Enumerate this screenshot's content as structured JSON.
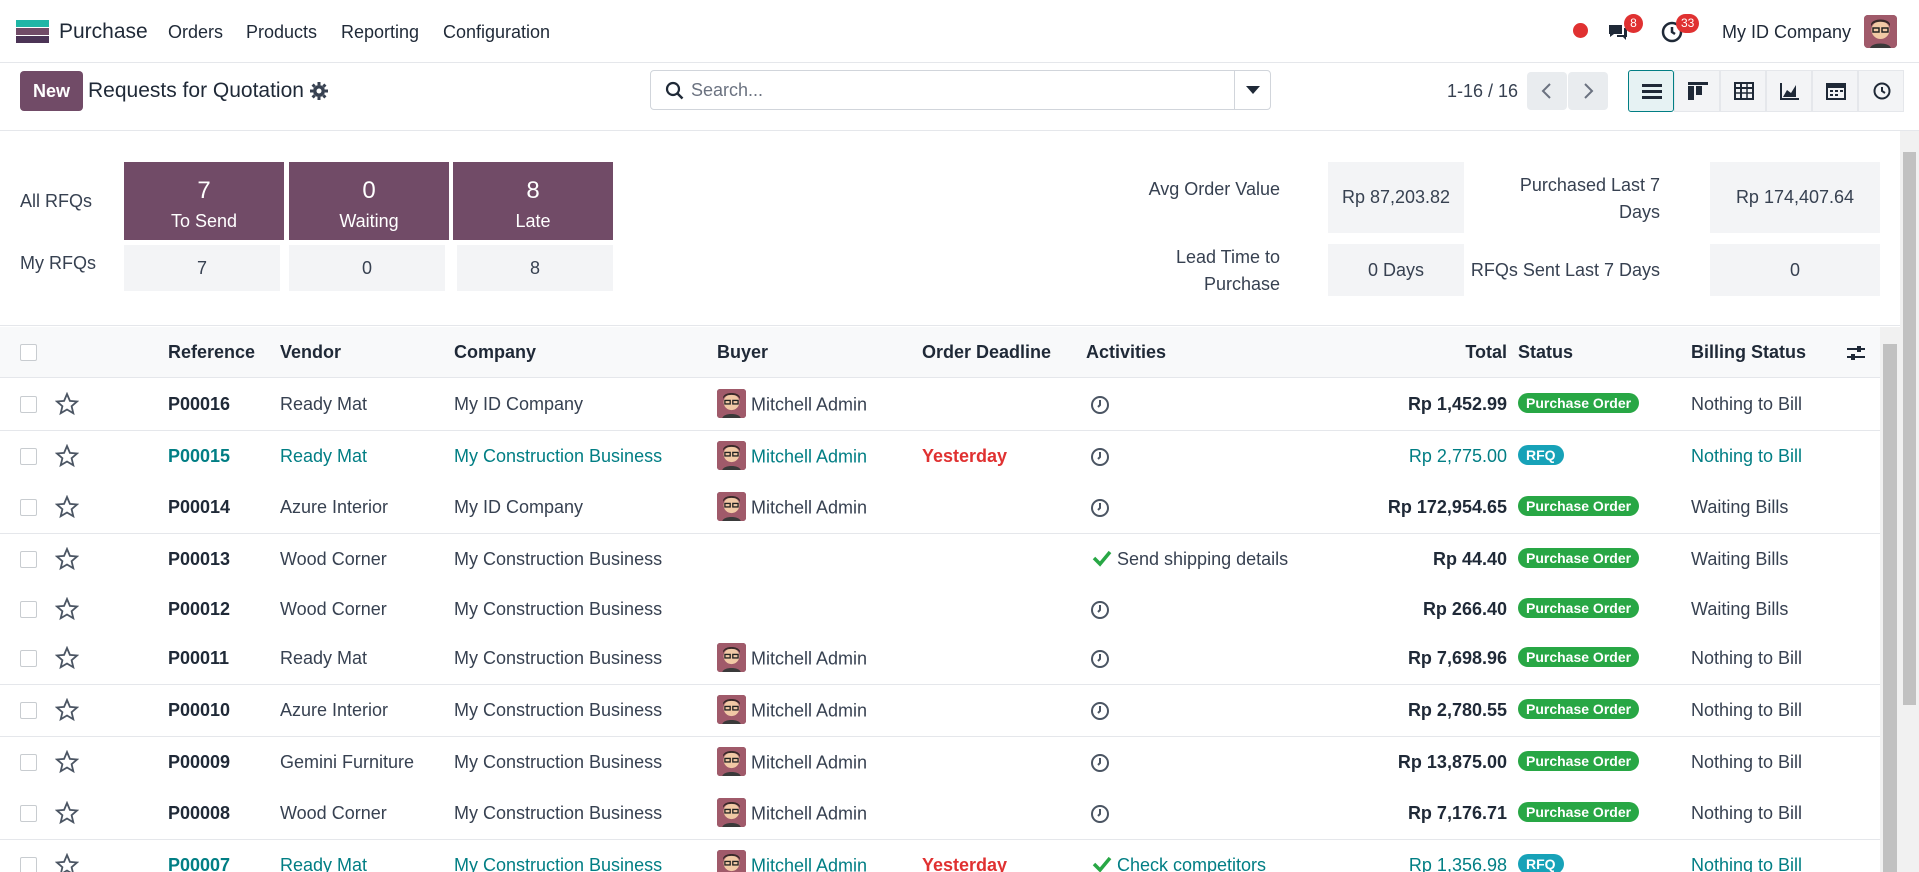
{
  "navbar": {
    "app_name": "Purchase",
    "menu": [
      "Orders",
      "Products",
      "Reporting",
      "Configuration"
    ],
    "messages_badge": "8",
    "activities_badge": "33",
    "company": "My ID Company"
  },
  "control_panel": {
    "new_label": "New",
    "title": "Requests for Quotation",
    "search_placeholder": "Search...",
    "pager": "1-16 / 16"
  },
  "dashboard": {
    "all_label": "All RFQs",
    "my_label": "My RFQs",
    "tiles": [
      {
        "count": "7",
        "label": "To Send"
      },
      {
        "count": "0",
        "label": "Waiting"
      },
      {
        "count": "8",
        "label": "Late"
      }
    ],
    "my_counts": [
      "7",
      "0",
      "8"
    ],
    "avg_order_label": "Avg Order Value",
    "avg_order_value": "Rp 87,203.82",
    "lead_time_label_1": "Lead Time to",
    "lead_time_label_2": "Purchase",
    "lead_time_value": "0 Days",
    "purchased_label_1": "Purchased Last 7",
    "purchased_label_2": "Days",
    "purchased_value": "Rp 174,407.64",
    "rfq_sent_label": "RFQs Sent Last 7 Days",
    "rfq_sent_value": "0"
  },
  "table": {
    "headers": {
      "reference": "Reference",
      "vendor": "Vendor",
      "company": "Company",
      "buyer": "Buyer",
      "deadline": "Order Deadline",
      "activities": "Activities",
      "total": "Total",
      "status": "Status",
      "billing": "Billing Status"
    },
    "rows": [
      {
        "ref": "P00016",
        "vendor": "Ready Mat",
        "company": "My ID Company",
        "buyer": "Mitchell Admin",
        "deadline": "",
        "activity": "",
        "total": "Rp 1,452.99",
        "status": "Purchase Order",
        "billing": "Nothing to Bill",
        "highlight": false
      },
      {
        "ref": "P00015",
        "vendor": "Ready Mat",
        "company": "My Construction Business",
        "buyer": "Mitchell Admin",
        "deadline": "Yesterday",
        "activity": "",
        "total": "Rp 2,775.00",
        "status": "RFQ",
        "billing": "Nothing to Bill",
        "highlight": true
      },
      {
        "ref": "P00014",
        "vendor": "Azure Interior",
        "company": "My ID Company",
        "buyer": "Mitchell Admin",
        "deadline": "",
        "activity": "",
        "total": "Rp 172,954.65",
        "status": "Purchase Order",
        "billing": "Waiting Bills",
        "highlight": false
      },
      {
        "ref": "P00013",
        "vendor": "Wood Corner",
        "company": "My Construction Business",
        "buyer": "",
        "deadline": "",
        "activity": "Send shipping details",
        "total": "Rp 44.40",
        "status": "Purchase Order",
        "billing": "Waiting Bills",
        "highlight": false
      },
      {
        "ref": "P00012",
        "vendor": "Wood Corner",
        "company": "My Construction Business",
        "buyer": "",
        "deadline": "",
        "activity": "",
        "total": "Rp 266.40",
        "status": "Purchase Order",
        "billing": "Waiting Bills",
        "highlight": false
      },
      {
        "ref": "P00011",
        "vendor": "Ready Mat",
        "company": "My Construction Business",
        "buyer": "Mitchell Admin",
        "deadline": "",
        "activity": "",
        "total": "Rp 7,698.96",
        "status": "Purchase Order",
        "billing": "Nothing to Bill",
        "highlight": false
      },
      {
        "ref": "P00010",
        "vendor": "Azure Interior",
        "company": "My Construction Business",
        "buyer": "Mitchell Admin",
        "deadline": "",
        "activity": "",
        "total": "Rp 2,780.55",
        "status": "Purchase Order",
        "billing": "Nothing to Bill",
        "highlight": false
      },
      {
        "ref": "P00009",
        "vendor": "Gemini Furniture",
        "company": "My Construction Business",
        "buyer": "Mitchell Admin",
        "deadline": "",
        "activity": "",
        "total": "Rp 13,875.00",
        "status": "Purchase Order",
        "billing": "Nothing to Bill",
        "highlight": false
      },
      {
        "ref": "P00008",
        "vendor": "Wood Corner",
        "company": "My Construction Business",
        "buyer": "Mitchell Admin",
        "deadline": "",
        "activity": "",
        "total": "Rp 7,176.71",
        "status": "Purchase Order",
        "billing": "Nothing to Bill",
        "highlight": false
      },
      {
        "ref": "P00007",
        "vendor": "Ready Mat",
        "company": "My Construction Business",
        "buyer": "Mitchell Admin",
        "deadline": "Yesterday",
        "activity": "Check competitors",
        "total": "Rp 1,356.98",
        "status": "RFQ",
        "billing": "Nothing to Bill",
        "highlight": true
      }
    ]
  },
  "colors": {
    "brand": "#714b67",
    "link": "#017e84",
    "status_po": "#28a745",
    "status_rfq": "#17a2b8",
    "danger": "#e03131"
  }
}
